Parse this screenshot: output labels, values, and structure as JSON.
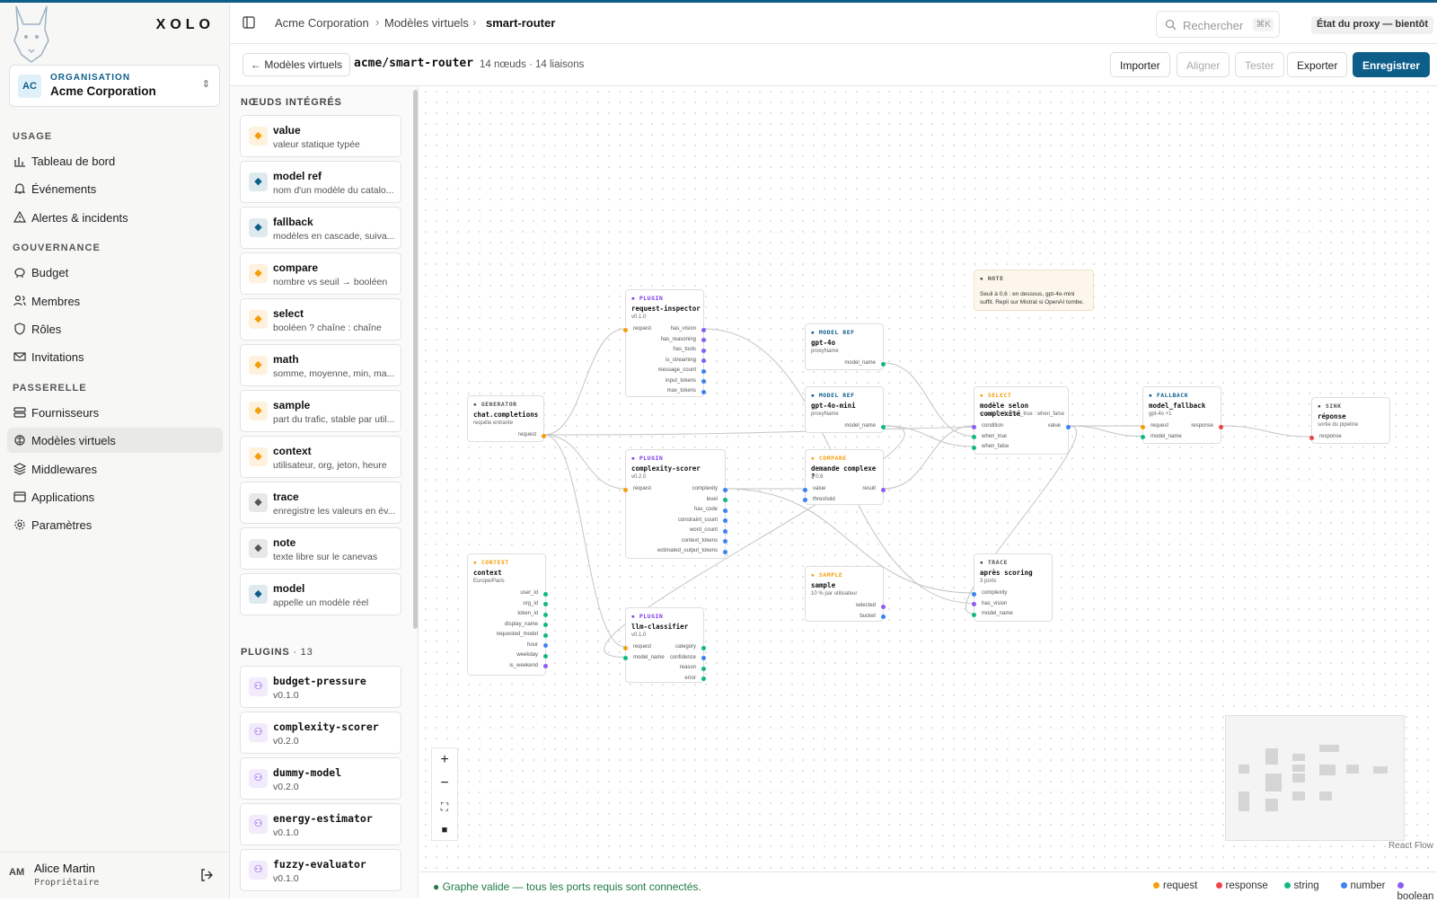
{
  "app": {
    "brand": "XOLO"
  },
  "org": {
    "label": "ORGANISATION",
    "name": "Acme Corporation",
    "initials": "AC"
  },
  "sidebar": {
    "sections": [
      {
        "title": "USAGE",
        "items": [
          {
            "label": "Tableau de bord",
            "icon": "chart-icon"
          },
          {
            "label": "Événements",
            "icon": "bell-icon"
          },
          {
            "label": "Alertes & incidents",
            "icon": "warning-icon"
          }
        ]
      },
      {
        "title": "GOUVERNANCE",
        "items": [
          {
            "label": "Budget",
            "icon": "piggy-bank-icon"
          },
          {
            "label": "Membres",
            "icon": "users-icon"
          },
          {
            "label": "Rôles",
            "icon": "shield-icon"
          },
          {
            "label": "Invitations",
            "icon": "mail-icon"
          }
        ]
      },
      {
        "title": "PASSERELLE",
        "items": [
          {
            "label": "Fournisseurs",
            "icon": "server-icon"
          },
          {
            "label": "Modèles virtuels",
            "icon": "brain-icon",
            "active": true
          },
          {
            "label": "Middlewares",
            "icon": "layers-icon"
          },
          {
            "label": "Applications",
            "icon": "app-window-icon"
          },
          {
            "label": "Paramètres",
            "icon": "gear-icon"
          }
        ]
      }
    ],
    "user": {
      "initials": "AM",
      "name": "Alice Martin",
      "role": "Propriétaire"
    }
  },
  "header": {
    "breadcrumb": [
      "Acme Corporation",
      "Modèles virtuels",
      "smart-router"
    ],
    "search_placeholder": "Rechercher",
    "search_shortcut": "⌘K",
    "proxy_status": "État du proxy — bientôt"
  },
  "toolbar": {
    "back": "← Modèles virtuels",
    "title": "acme/smart-router",
    "meta": "14 nœuds · 14 liaisons",
    "import": "Importer",
    "align": "Aligner",
    "test": "Tester",
    "export": "Exporter",
    "save": "Enregistrer"
  },
  "palette": {
    "builtin_title": "NŒUDS INTÉGRÉS",
    "builtin": [
      {
        "name": "value",
        "desc": "valeur statique typée",
        "icon": "value-icon",
        "color": "#f59e0b"
      },
      {
        "name": "model ref",
        "desc": "nom d'un modèle du catalo...",
        "icon": "brain-icon",
        "color": "#0e5e8a"
      },
      {
        "name": "fallback",
        "desc": "modèles en cascade, suiva...",
        "icon": "fallback-icon",
        "color": "#0e5e8a"
      },
      {
        "name": "compare",
        "desc": "nombre vs seuil → booléen",
        "icon": "compare-icon",
        "color": "#f59e0b"
      },
      {
        "name": "select",
        "desc": "booléen ? chaîne : chaîne",
        "icon": "select-icon",
        "color": "#f59e0b"
      },
      {
        "name": "math",
        "desc": "somme, moyenne, min, ma...",
        "icon": "math-icon",
        "color": "#f59e0b"
      },
      {
        "name": "sample",
        "desc": "part du trafic, stable par util...",
        "icon": "clock-icon",
        "color": "#f59e0b"
      },
      {
        "name": "context",
        "desc": "utilisateur, org, jeton, heure",
        "icon": "user-icon",
        "color": "#f59e0b"
      },
      {
        "name": "trace",
        "desc": "enregistre les valeurs en év...",
        "icon": "trace-icon",
        "color": "#555555"
      },
      {
        "name": "note",
        "desc": "texte libre sur le canevas",
        "icon": "note-icon",
        "color": "#555555"
      },
      {
        "name": "model",
        "desc": "appelle un modèle réel",
        "icon": "brain-icon",
        "color": "#0e5e8a"
      }
    ],
    "plugins_title": "PLUGINS",
    "plugins_count": "· 13",
    "plugins": [
      {
        "name": "budget-pressure",
        "version": "v0.1.0"
      },
      {
        "name": "complexity-scorer",
        "version": "v0.2.0"
      },
      {
        "name": "dummy-model",
        "version": "v0.2.0"
      },
      {
        "name": "energy-estimator",
        "version": "v0.1.0"
      },
      {
        "name": "fuzzy-evaluator",
        "version": "v0.1.0"
      }
    ]
  },
  "graph": {
    "nodes": {
      "generator": {
        "kind": "GENERATOR",
        "title": "chat.completions",
        "sub": "requête entrante",
        "out": [
          "request"
        ]
      },
      "context": {
        "kind": "CONTEXT",
        "title": "context",
        "sub": "Europe/Paris",
        "out": [
          "user_id",
          "org_id",
          "token_id",
          "display_name",
          "requested_model",
          "hour",
          "weekday",
          "is_weekend"
        ]
      },
      "inspector": {
        "kind": "PLUGIN",
        "title": "request-inspector",
        "sub": "v0.1.0",
        "in": [
          "request"
        ],
        "out": [
          "has_vision",
          "has_reasoning",
          "has_tools",
          "is_streaming",
          "message_count",
          "input_tokens",
          "max_tokens"
        ]
      },
      "scorer": {
        "kind": "PLUGIN",
        "title": "complexity-scorer",
        "sub": "v0.2.0",
        "in": [
          "request"
        ],
        "out": [
          "complexity",
          "level",
          "has_code",
          "constraint_count",
          "word_count",
          "context_tokens",
          "estimated_output_tokens"
        ]
      },
      "classifier": {
        "kind": "PLUGIN",
        "title": "llm-classifier",
        "sub": "v0.1.0",
        "in": [
          "request",
          "model_name"
        ],
        "out": [
          "category",
          "confidence",
          "reason",
          "error"
        ]
      },
      "gpt4o": {
        "kind": "MODEL REF",
        "title": "gpt-4o",
        "sub": "proxyName",
        "out": [
          "model_name"
        ]
      },
      "gpt4omini": {
        "kind": "MODEL REF",
        "title": "gpt-4o-mini",
        "sub": "proxyName",
        "out": [
          "model_name"
        ]
      },
      "compare": {
        "kind": "COMPARE",
        "title": "demande complexe ?",
        "sub": "> 0.6",
        "in": [
          "value",
          "threshold"
        ],
        "out": [
          "result"
        ]
      },
      "sample": {
        "kind": "SAMPLE",
        "title": "sample",
        "sub": "10 % par utilisateur",
        "out": [
          "selected",
          "bucket"
        ]
      },
      "note": {
        "kind": "NOTE",
        "text": "Seuil à 0,6 : en dessous, gpt-4o-mini suffit. Repli sur Mistral si OpenAI tombe."
      },
      "select": {
        "kind": "SELECT",
        "title": "modèle selon complexité",
        "sub": "condition ? when_true : when_false",
        "in": [
          "condition",
          "when_true",
          "when_false"
        ],
        "out": [
          "value"
        ]
      },
      "trace": {
        "kind": "TRACE",
        "title": "après scoring",
        "sub": "3 ports",
        "in": [
          "complexity",
          "has_vision",
          "model_name"
        ]
      },
      "fallback": {
        "kind": "FALLBACK",
        "title": "model_fallback",
        "sub": "gpt-4o +1",
        "in": [
          "request",
          "model_name"
        ],
        "out": [
          "response"
        ]
      },
      "sink": {
        "kind": "SINK",
        "title": "réponse",
        "sub": "sortie du pipeline",
        "in": [
          "response"
        ]
      }
    },
    "attribution": "React Flow"
  },
  "status": {
    "message": "Graphe valide — tous les ports requis sont connectés.",
    "legend": [
      {
        "label": "request",
        "color": "#f59e0b"
      },
      {
        "label": "response",
        "color": "#ef4444"
      },
      {
        "label": "string",
        "color": "#10b981"
      },
      {
        "label": "number",
        "color": "#3b82f6"
      },
      {
        "label": "boolean",
        "color": "#8b5cf6"
      }
    ]
  }
}
